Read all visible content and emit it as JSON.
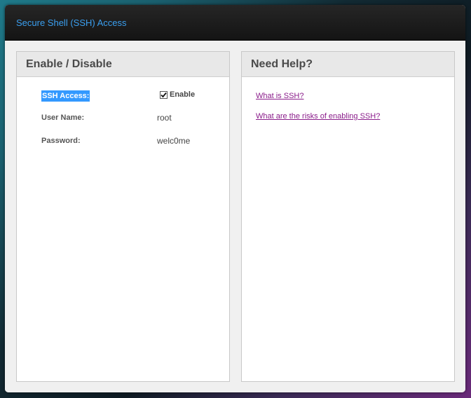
{
  "window": {
    "title": "Secure Shell (SSH) Access"
  },
  "enable_panel": {
    "heading": "Enable / Disable",
    "ssh_access": {
      "label": "SSH Access:",
      "checkbox_label": "Enable",
      "checked": true
    },
    "user_name": {
      "label": "User Name:",
      "value": "root"
    },
    "password": {
      "label": "Password:",
      "value": "welc0me"
    }
  },
  "help_panel": {
    "heading": "Need Help?",
    "links": [
      "What is SSH?",
      "What are the risks of enabling SSH?"
    ]
  },
  "colors": {
    "title_text": "#3a9ff0",
    "link": "#8a1c8a",
    "selection": "#3399ff"
  }
}
